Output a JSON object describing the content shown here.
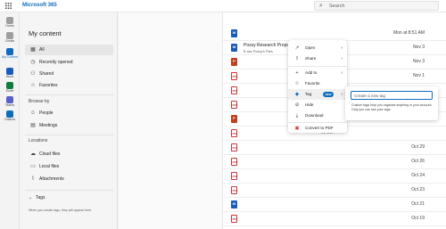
{
  "header": {
    "app_title": "Microsoft 365",
    "search_placeholder": "Search",
    "app_launcher_icon": "app-launcher-icon",
    "search_icon": "search-icon"
  },
  "rail": [
    {
      "label": "Home",
      "icon": "home-icon",
      "color": "#9e9e9e"
    },
    {
      "label": "Create",
      "icon": "create-icon",
      "color": "#9e9e9e"
    },
    {
      "label": "My Content",
      "icon": "folder-icon",
      "color": "#0f6cbd"
    },
    {
      "label": "Word",
      "icon": "word-app-icon",
      "color": "#185abd"
    },
    {
      "label": "Excel",
      "icon": "excel-app-icon",
      "color": "#107c41"
    },
    {
      "label": "Teams",
      "icon": "teams-app-icon",
      "color": "#5b5fc7"
    },
    {
      "label": "Outlook",
      "icon": "outlook-app-icon",
      "color": "#0f6cbd"
    }
  ],
  "sidebar": {
    "title": "My content",
    "nav": [
      {
        "label": "All",
        "icon": "all-icon"
      },
      {
        "label": "Recently opened",
        "icon": "clock-icon"
      },
      {
        "label": "Shared",
        "icon": "shared-icon"
      },
      {
        "label": "Favorites",
        "icon": "star-icon"
      }
    ],
    "browse_label": "Browse by",
    "browse": [
      {
        "label": "People",
        "icon": "people-icon"
      },
      {
        "label": "Meetings",
        "icon": "calendar-icon"
      }
    ],
    "locations_label": "Locations",
    "locations": [
      {
        "label": "Cloud files",
        "icon": "cloud-icon"
      },
      {
        "label": "Local files",
        "icon": "monitor-icon"
      },
      {
        "label": "Attachments",
        "icon": "paperclip-icon"
      }
    ],
    "tags_label": "Tags",
    "tags_hint": "When you create tags, they will appear here."
  },
  "files": [
    {
      "type": "word",
      "name": "",
      "sub": "",
      "date": "Mon at 8:51 AM",
      "frag": ""
    },
    {
      "type": "word",
      "name": "Possy Research Proposal",
      "sub": "B ase Possy's Files",
      "date": "Nov 3",
      "frag": ""
    },
    {
      "type": "ppt",
      "name": "",
      "sub": "",
      "date": "Nov 3",
      "frag": ""
    },
    {
      "type": "pdf",
      "name": "",
      "sub": "",
      "date": "Nov 1",
      "frag": "/6/"
    },
    {
      "type": "pdf",
      "name": "",
      "sub": "",
      "date": "",
      "frag": "ew Ag"
    },
    {
      "type": "pdf",
      "name": "",
      "sub": "",
      "date": "",
      "frag": ""
    },
    {
      "type": "ppt",
      "name": "",
      "sub": "",
      "date": "",
      "frag": ""
    },
    {
      "type": "pdf",
      "name": "",
      "sub": "",
      "date": "",
      "frag": "ive ara..."
    },
    {
      "type": "pdf",
      "name": "",
      "sub": "",
      "date": "Oct 29",
      "frag": ""
    },
    {
      "type": "pdf",
      "name": "",
      "sub": "",
      "date": "Oct 26",
      "frag": ""
    },
    {
      "type": "pdf",
      "name": "",
      "sub": "",
      "date": "Oct 24",
      "frag": ""
    },
    {
      "type": "pdf",
      "name": "",
      "sub": "",
      "date": "Oct 23",
      "frag": ""
    },
    {
      "type": "word",
      "name": "",
      "sub": "",
      "date": "Oct 21",
      "frag": ""
    },
    {
      "type": "pdf",
      "name": "",
      "sub": "",
      "date": "Oct 19",
      "frag": ""
    }
  ],
  "context_menu": {
    "items": [
      {
        "label": "Open",
        "icon": "open-icon",
        "submenu": true
      },
      {
        "label": "Share",
        "icon": "share-icon",
        "submenu": true
      },
      {
        "label": "Add to",
        "icon": "add-icon",
        "submenu": true
      },
      {
        "label": "Favorite",
        "icon": "star-icon",
        "submenu": false
      },
      {
        "label": "Tag",
        "icon": "tag-icon",
        "submenu": true,
        "badge": "NEW"
      },
      {
        "label": "Hide",
        "icon": "hide-icon",
        "submenu": false
      },
      {
        "label": "Download",
        "icon": "download-icon",
        "submenu": false
      },
      {
        "label": "Convert to PDF",
        "icon": "pdf-convert-icon",
        "submenu": false
      }
    ]
  },
  "tag_popup": {
    "input_placeholder": "Create a new tag",
    "hint": "Custom tags help you organize anything in your account. Only you can see your tags."
  },
  "colors": {
    "accent": "#0f6cbd",
    "word": "#185abd",
    "ppt": "#c43e1c",
    "pdf": "#d13438"
  }
}
